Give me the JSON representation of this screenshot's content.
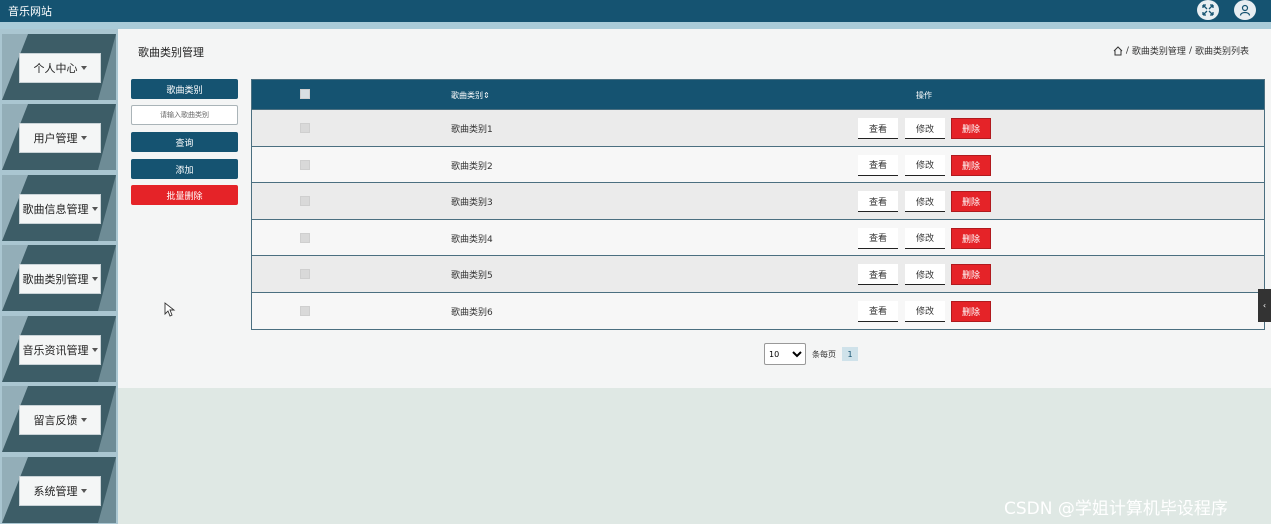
{
  "app": {
    "title": "音乐网站"
  },
  "topbar": {
    "icons": [
      "fullscreen-icon",
      "user-icon"
    ]
  },
  "sidebar": {
    "items": [
      {
        "label": "个人中心"
      },
      {
        "label": "用户管理"
      },
      {
        "label": "歌曲信息管理"
      },
      {
        "label": "歌曲类别管理"
      },
      {
        "label": "音乐资讯管理"
      },
      {
        "label": "留言反馈"
      },
      {
        "label": "系统管理"
      }
    ]
  },
  "page": {
    "title": "歌曲类别管理",
    "breadcrumb": {
      "sep": "/",
      "level1": "歌曲类别管理",
      "level2": "歌曲类别列表"
    }
  },
  "filters": {
    "field_label": "歌曲类别",
    "search_placeholder": "请输入歌曲类别",
    "query_button": "查询",
    "add_button": "添加",
    "batch_delete_button": "批量删除"
  },
  "table": {
    "columns": {
      "name": "歌曲类别",
      "operations": "操作"
    },
    "actions": {
      "view": "查看",
      "edit": "修改",
      "delete": "删除"
    },
    "rows": [
      {
        "name": "歌曲类别1"
      },
      {
        "name": "歌曲类别2"
      },
      {
        "name": "歌曲类别3"
      },
      {
        "name": "歌曲类别4"
      },
      {
        "name": "歌曲类别5"
      },
      {
        "name": "歌曲类别6"
      }
    ]
  },
  "pagination": {
    "page_size": "10",
    "page_size_options": [
      "10"
    ],
    "per_page_label": "条每页",
    "current_page": "1"
  },
  "watermark": "CSDN @学姐计算机毕设程序",
  "colors": {
    "primary": "#155371",
    "danger": "#e52328",
    "sidebar": "#aac6d1"
  }
}
